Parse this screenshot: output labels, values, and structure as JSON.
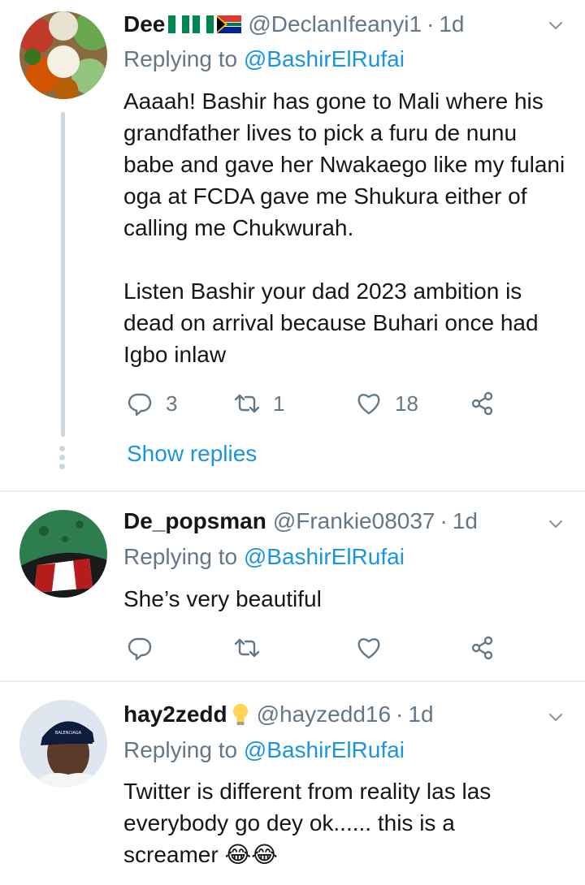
{
  "tweets": [
    {
      "display_name": "Dee",
      "flags": "🇳🇬🇳🇬🇿🇦",
      "handle": "@DeclanIfeanyi1",
      "separator": "·",
      "time": "1d",
      "replying_prefix": "Replying to",
      "replying_to": "@BashirElRufai",
      "paragraphs": [
        "Aaaah! Bashir has gone to Mali where his grandfather lives to pick a furu de nunu babe and gave her Nwakaego like my fulani oga at FCDA gave me Shukura either of calling me Chukwurah.",
        "Listen Bashir your dad 2023 ambition is dead on arrival because   Buhari once had Igbo inlaw"
      ],
      "reply_count": "3",
      "retweet_count": "1",
      "like_count": "18",
      "show_replies": "Show replies"
    },
    {
      "display_name": "De_popsman",
      "handle": "@Frankie08037",
      "separator": "·",
      "time": "1d",
      "replying_prefix": "Replying to",
      "replying_to": "@BashirElRufai",
      "paragraphs": [
        "She’s very beautiful"
      ]
    },
    {
      "display_name": "hay2zedd",
      "badge_emoji": "💡",
      "handle": "@hayzedd16",
      "separator": "·",
      "time": "1d",
      "replying_prefix": "Replying to",
      "replying_to": "@BashirElRufai",
      "paragraphs": [
        "Twitter is different from reality las las everybody go dey ok...... this is a screamer 😂😂"
      ]
    }
  ],
  "colors": {
    "text": "#14171a",
    "secondary": "#657786",
    "link": "#1b95e0",
    "divider": "#e6ecf0",
    "thread_line": "#ccd6dd"
  },
  "icons": [
    "reply-icon",
    "retweet-icon",
    "like-icon",
    "share-icon",
    "caret-down-icon"
  ]
}
